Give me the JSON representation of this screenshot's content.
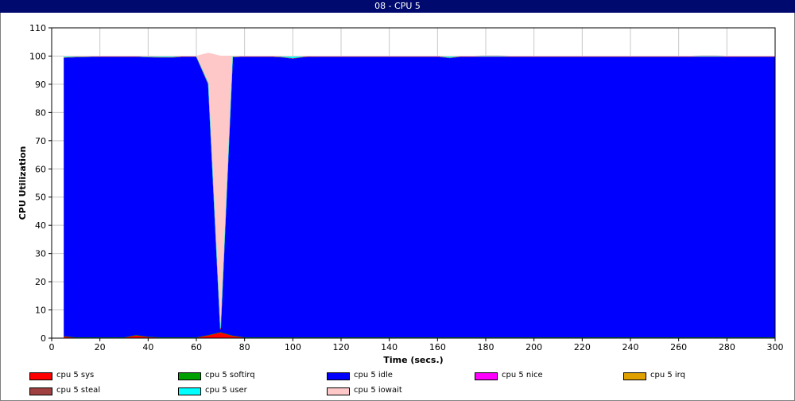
{
  "window": {
    "title": "08 - CPU 5"
  },
  "chart_data": {
    "type": "area",
    "stacked": true,
    "title": "",
    "xlabel": "Time (secs.)",
    "ylabel": "CPU Utilization",
    "xlim": [
      0,
      300
    ],
    "ylim": [
      0,
      110
    ],
    "xticks": [
      0,
      20,
      40,
      60,
      80,
      100,
      120,
      140,
      160,
      180,
      200,
      220,
      240,
      260,
      280,
      300
    ],
    "yticks": [
      0,
      10,
      20,
      30,
      40,
      50,
      60,
      70,
      80,
      90,
      100,
      110
    ],
    "grid": true,
    "legend_position": "bottom",
    "x": [
      5,
      10,
      15,
      20,
      25,
      30,
      35,
      40,
      45,
      50,
      55,
      60,
      65,
      70,
      75,
      80,
      85,
      90,
      95,
      100,
      105,
      110,
      115,
      120,
      125,
      130,
      135,
      140,
      145,
      150,
      155,
      160,
      165,
      170,
      175,
      180,
      185,
      190,
      195,
      200,
      205,
      210,
      215,
      220,
      225,
      230,
      235,
      240,
      245,
      250,
      255,
      260,
      265,
      270,
      275,
      280,
      285,
      290,
      295,
      300
    ],
    "series": [
      {
        "name": "cpu 5 sys",
        "color": "#ff0000",
        "values": [
          0.6,
          0.2,
          0.2,
          0.2,
          0.2,
          0.2,
          1.0,
          0.4,
          0.2,
          0.2,
          0.2,
          0.2,
          1.0,
          2.0,
          0.8,
          0.2,
          0.2,
          0.2,
          0.2,
          0.2,
          0.2,
          0.2,
          0.2,
          0.2,
          0.2,
          0.2,
          0.2,
          0.2,
          0.2,
          0.2,
          0.2,
          0.2,
          0.2,
          0.2,
          0.2,
          0.2,
          0.2,
          0.2,
          0.2,
          0.2,
          0.2,
          0.2,
          0.2,
          0.2,
          0.2,
          0.2,
          0.2,
          0.2,
          0.2,
          0.2,
          0.2,
          0.2,
          0.2,
          0.2,
          0.2,
          0.2,
          0.2,
          0.2,
          0.2,
          0.2
        ]
      },
      {
        "name": "cpu 5 softirq",
        "color": "#00a000",
        "values": [
          0.1,
          0.1,
          0.1,
          0.1,
          0.1,
          0.1,
          0.1,
          0.1,
          0.1,
          0.1,
          0.1,
          0.1,
          0.1,
          0.1,
          0.1,
          0.1,
          0.1,
          0.1,
          0.1,
          0.1,
          0.1,
          0.1,
          0.1,
          0.1,
          0.1,
          0.1,
          0.1,
          0.1,
          0.1,
          0.1,
          0.1,
          0.1,
          0.1,
          0.1,
          0.1,
          0.1,
          0.1,
          0.1,
          0.1,
          0.1,
          0.1,
          0.1,
          0.1,
          0.1,
          0.1,
          0.1,
          0.1,
          0.1,
          0.1,
          0.1,
          0.1,
          0.1,
          0.1,
          0.1,
          0.1,
          0.1,
          0.1,
          0.1,
          0.1,
          0.1
        ]
      },
      {
        "name": "cpu 5 idle",
        "color": "#0000ff",
        "values": [
          98.8,
          99.4,
          99.5,
          99.6,
          99.6,
          99.6,
          98.8,
          99.2,
          99.3,
          99.3,
          99.6,
          99.6,
          88.9,
          1.0,
          98.8,
          99.6,
          99.6,
          99.6,
          99.4,
          98.9,
          99.5,
          99.6,
          99.6,
          99.6,
          99.6,
          99.6,
          99.6,
          99.6,
          99.6,
          99.6,
          99.6,
          99.6,
          99.1,
          99.6,
          99.6,
          99.6,
          99.6,
          99.6,
          99.6,
          99.6,
          99.6,
          99.6,
          99.6,
          99.6,
          99.6,
          99.6,
          99.6,
          99.6,
          99.6,
          99.6,
          99.6,
          99.6,
          99.6,
          99.6,
          99.6,
          99.6,
          99.6,
          99.6,
          99.6,
          99.6
        ]
      },
      {
        "name": "cpu 5 nice",
        "color": "#ff00ff",
        "values": [
          0,
          0,
          0,
          0,
          0,
          0,
          0,
          0,
          0,
          0,
          0,
          0,
          0,
          0,
          0,
          0,
          0,
          0,
          0,
          0,
          0,
          0,
          0,
          0,
          0,
          0,
          0,
          0,
          0,
          0,
          0,
          0,
          0,
          0,
          0,
          0,
          0,
          0,
          0,
          0,
          0,
          0,
          0,
          0,
          0,
          0,
          0,
          0,
          0,
          0,
          0,
          0,
          0,
          0,
          0,
          0,
          0,
          0,
          0,
          0
        ]
      },
      {
        "name": "cpu 5 irq",
        "color": "#e0a000",
        "values": [
          0,
          0,
          0,
          0,
          0,
          0,
          0,
          0,
          0,
          0,
          0,
          0,
          0,
          0,
          0,
          0,
          0,
          0,
          0,
          0,
          0,
          0,
          0,
          0,
          0,
          0,
          0,
          0,
          0,
          0,
          0,
          0,
          0,
          0,
          0,
          0,
          0,
          0,
          0,
          0,
          0,
          0,
          0,
          0,
          0,
          0,
          0,
          0,
          0,
          0,
          0,
          0,
          0,
          0,
          0,
          0,
          0,
          0,
          0,
          0
        ]
      },
      {
        "name": "cpu 5 steal",
        "color": "#a04040",
        "values": [
          0,
          0,
          0,
          0,
          0,
          0,
          0,
          0,
          0,
          0,
          0,
          0,
          0,
          0,
          0,
          0,
          0,
          0,
          0,
          0,
          0,
          0,
          0,
          0,
          0,
          0,
          0,
          0,
          0,
          0,
          0,
          0,
          0,
          0,
          0,
          0,
          0,
          0,
          0,
          0,
          0,
          0,
          0,
          0,
          0,
          0,
          0,
          0,
          0,
          0,
          0,
          0,
          0,
          0,
          0,
          0,
          0,
          0,
          0,
          0
        ]
      },
      {
        "name": "cpu 5 user",
        "color": "#00ffff",
        "values": [
          0.3,
          0.2,
          0.1,
          0.1,
          0.1,
          0.1,
          0.1,
          0.1,
          0.4,
          0.4,
          0.1,
          0.1,
          0.5,
          0.6,
          0.2,
          0.1,
          0.1,
          0.1,
          0.3,
          0.6,
          0.2,
          0.1,
          0.1,
          0.1,
          0.1,
          0.1,
          0.1,
          0.1,
          0.1,
          0.1,
          0.1,
          0.1,
          0.6,
          0.1,
          0.1,
          0.1,
          0.1,
          0.1,
          0.1,
          0.1,
          0.1,
          0.1,
          0.1,
          0.1,
          0.1,
          0.1,
          0.1,
          0.1,
          0.1,
          0.1,
          0.1,
          0.1,
          0.1,
          0.1,
          0.1,
          0.1,
          0.1,
          0.1,
          0.1,
          0.1
        ]
      },
      {
        "name": "cpu 5 iowait",
        "color": "#ffc8c8",
        "values": [
          0.2,
          0.1,
          0.1,
          0,
          0,
          0,
          0,
          0.2,
          0,
          0,
          0,
          0,
          10.5,
          96.3,
          0.1,
          0,
          0,
          0,
          0,
          0.2,
          0,
          0,
          0,
          0,
          0,
          0,
          0,
          0,
          0,
          0,
          0,
          0,
          0,
          0,
          0,
          0.2,
          0.2,
          0,
          0,
          0,
          0,
          0,
          0,
          0,
          0,
          0,
          0,
          0,
          0,
          0,
          0,
          0,
          0,
          0.2,
          0.2,
          0,
          0,
          0,
          0,
          0
        ]
      }
    ]
  }
}
